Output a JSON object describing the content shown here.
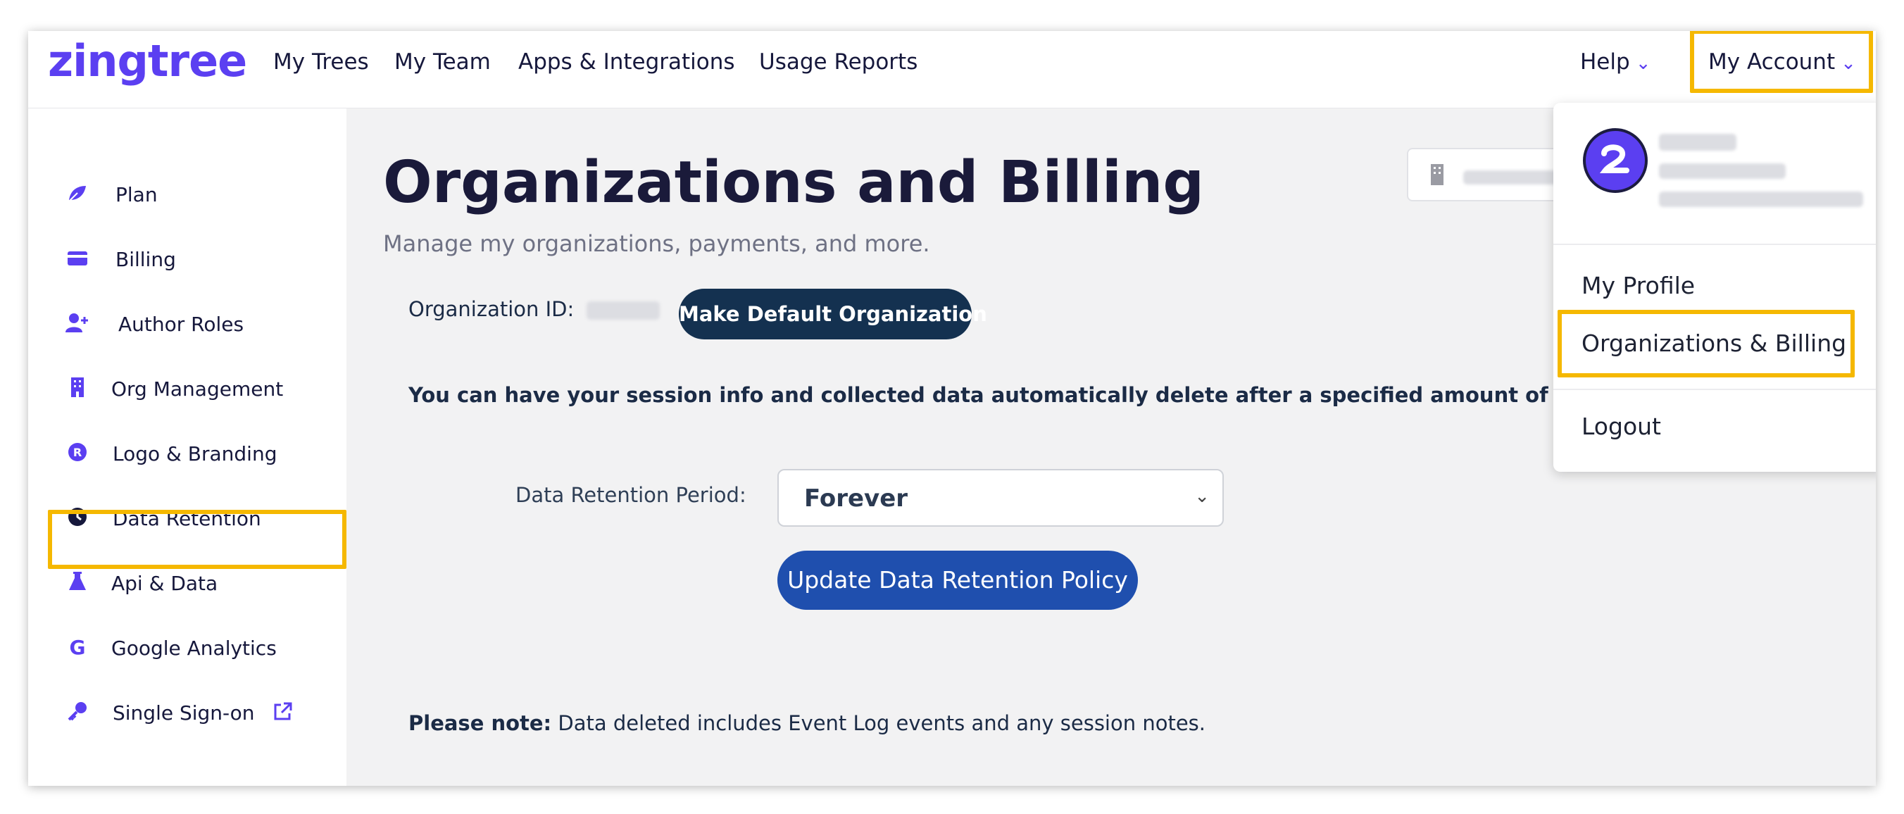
{
  "header": {
    "logo": "zingtree",
    "nav": [
      "My Trees",
      "My Team",
      "Apps & Integrations",
      "Usage Reports"
    ],
    "help_label": "Help",
    "account_label": "My Account"
  },
  "sidebar": {
    "items": [
      {
        "label": "Plan",
        "icon": "leaf-icon"
      },
      {
        "label": "Billing",
        "icon": "credit-card-icon"
      },
      {
        "label": "Author Roles",
        "icon": "add-user-icon"
      },
      {
        "label": "Org Management",
        "icon": "building-icon"
      },
      {
        "label": "Logo & Branding",
        "icon": "registered-icon"
      },
      {
        "label": "Data Retention",
        "icon": "clock-icon",
        "active": true
      },
      {
        "label": "Api & Data",
        "icon": "flask-icon"
      },
      {
        "label": "Google Analytics",
        "icon": "google-icon"
      },
      {
        "label": "Single Sign-on",
        "icon": "key-icon",
        "external_icon": "external-link-icon"
      }
    ]
  },
  "main": {
    "title": "Organizations and Billing",
    "subtitle": "Manage my organizations, payments, and more.",
    "org_id_label": "Organization ID:",
    "make_default_button": "Make Default Organization",
    "description": "You can have your session info and collected data automatically delete after a specified amount of time:",
    "retention_label": "Data Retention Period:",
    "retention_value": "Forever",
    "update_button": "Update Data Retention Policy",
    "note_bold": "Please note:",
    "note_text": " Data deleted includes Event Log events and any session notes."
  },
  "account_menu": {
    "items": [
      "My Profile",
      "Organizations & Billing",
      "Logout"
    ]
  },
  "colors": {
    "brand": "#5b3ff1",
    "highlight": "#f5b800",
    "dark_button": "#143150",
    "blue_button": "#1f4fae"
  }
}
